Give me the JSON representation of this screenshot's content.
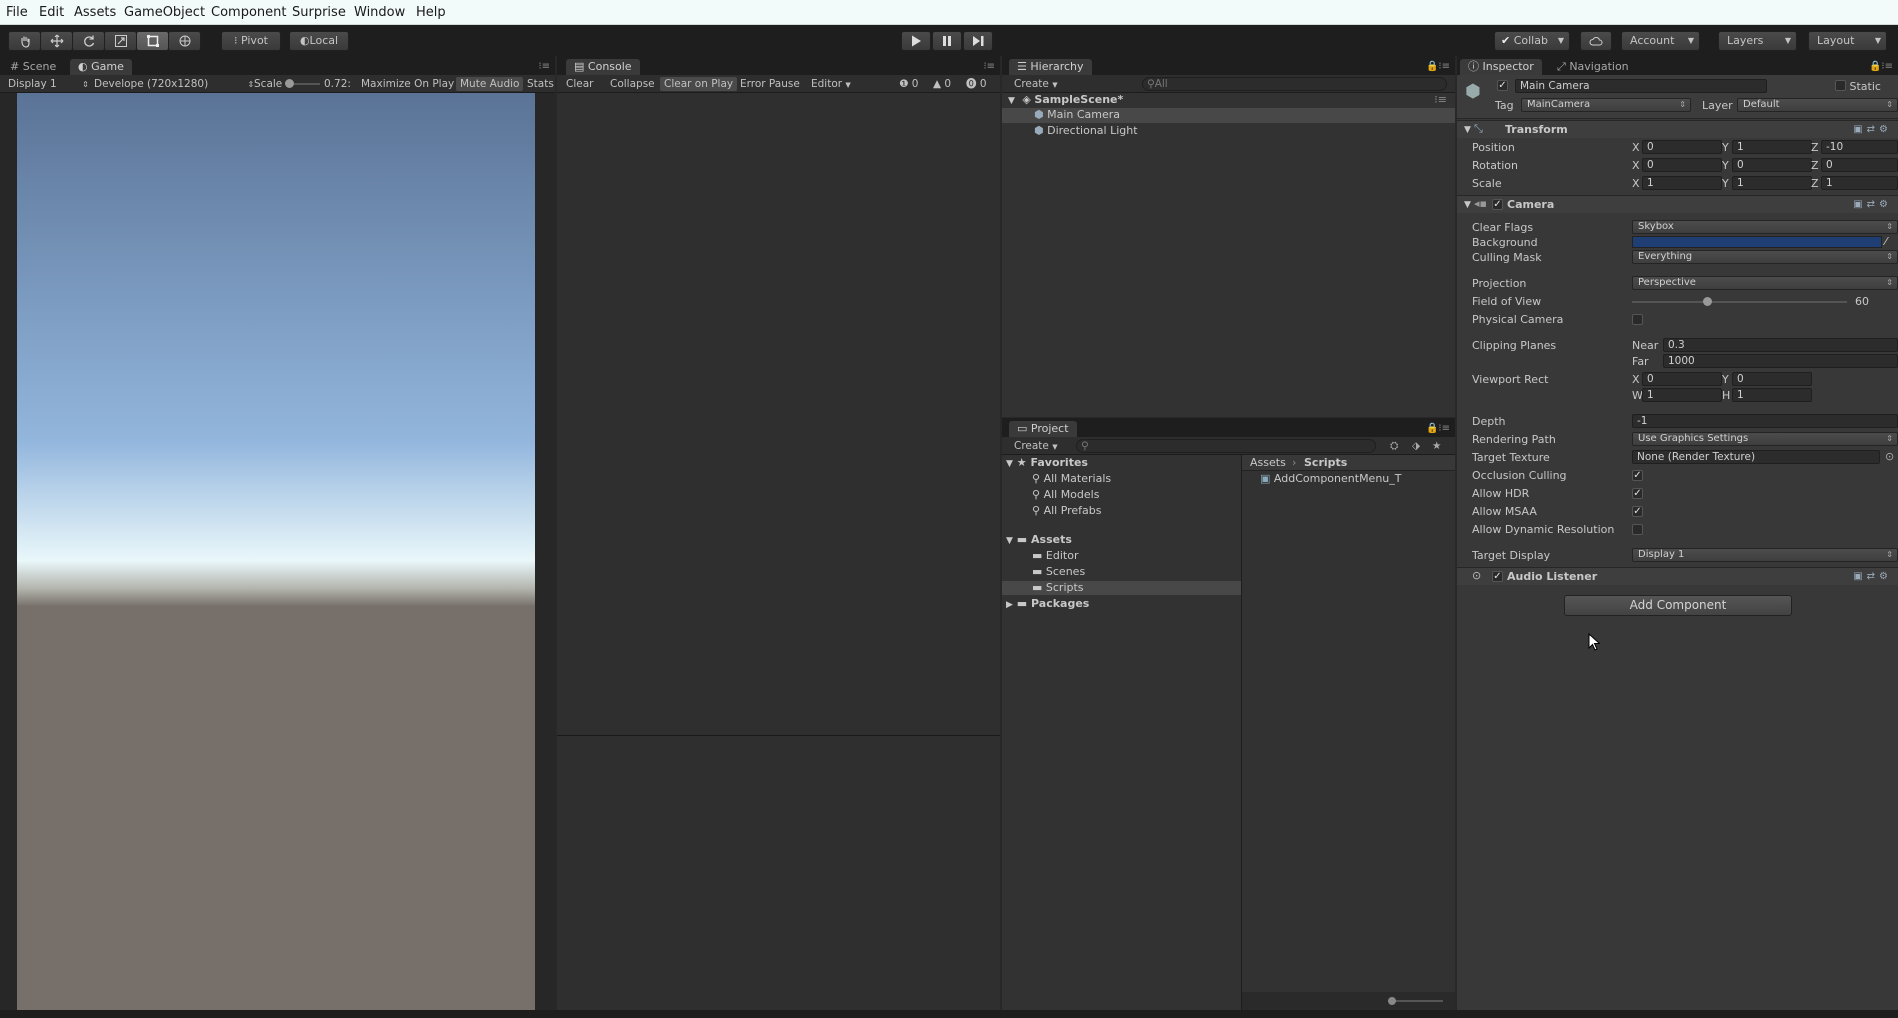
{
  "menu": [
    "File",
    "Edit",
    "Assets",
    "GameObject",
    "Component",
    "Surprise",
    "Window",
    "Help"
  ],
  "toolbar": {
    "tools": [
      "hand-icon",
      "move-icon",
      "rotate-icon",
      "scale-icon",
      "rect-icon",
      "transform-icon"
    ],
    "pivot": "Pivot",
    "local": "Local",
    "collab": "Collab",
    "account": "Account",
    "layers": "Layers",
    "layout": "Layout"
  },
  "game": {
    "tabs": [
      "Scene",
      "Game"
    ],
    "display": "Display 1",
    "resolution": "Develope (720x1280)",
    "scale_label": "Scale",
    "scale_value": "0.72:",
    "maximize": "Maximize On Play",
    "mute": "Mute Audio",
    "stats": "Stats",
    "sky_colors": [
      "#5a7396",
      "#93b6dd",
      "#e9f7fa",
      "#77706a"
    ]
  },
  "console": {
    "tab": "Console",
    "buttons": [
      "Clear",
      "Collapse",
      "Clear on Play",
      "Error Pause",
      "Editor"
    ],
    "counts": [
      "0",
      "0",
      "0"
    ]
  },
  "hierarchy": {
    "tab": "Hierarchy",
    "create": "Create",
    "search_placeholder": "All",
    "scene": "SampleScene*",
    "items": [
      "Main Camera",
      "Directional Light"
    ]
  },
  "project": {
    "tab": "Project",
    "create": "Create",
    "favorites_label": "Favorites",
    "favorites": [
      "All Materials",
      "All Models",
      "All Prefabs"
    ],
    "assets_label": "Assets",
    "folders": [
      "Editor",
      "Scenes",
      "Scripts"
    ],
    "packages_label": "Packages",
    "breadcrumb": [
      "Assets",
      "Scripts"
    ],
    "files": [
      "AddComponentMenu_T"
    ]
  },
  "inspector": {
    "tabs": [
      "Inspector",
      "Navigation"
    ],
    "object_name": "Main Camera",
    "static_label": "Static",
    "tag_label": "Tag",
    "tag_value": "MainCamera",
    "layer_label": "Layer",
    "layer_value": "Default",
    "transform": {
      "title": "Transform",
      "rows": [
        {
          "label": "Position",
          "x": "0",
          "y": "1",
          "z": "-10"
        },
        {
          "label": "Rotation",
          "x": "0",
          "y": "0",
          "z": "0"
        },
        {
          "label": "Scale",
          "x": "1",
          "y": "1",
          "z": "1"
        }
      ]
    },
    "camera": {
      "title": "Camera",
      "clear_flags_label": "Clear Flags",
      "clear_flags": "Skybox",
      "background_label": "Background",
      "background_color": "#1e3e74",
      "culling_label": "Culling Mask",
      "culling": "Everything",
      "projection_label": "Projection",
      "projection": "Perspective",
      "fov_label": "Field of View",
      "fov": "60",
      "fov_fraction": 0.33,
      "physical_label": "Physical Camera",
      "clipping_label": "Clipping Planes",
      "near_label": "Near",
      "near": "0.3",
      "far_label": "Far",
      "far": "1000",
      "viewport_label": "Viewport Rect",
      "vx": "0",
      "vy": "0",
      "vw": "1",
      "vh": "1",
      "depth_label": "Depth",
      "depth": "-1",
      "render_path_label": "Rendering Path",
      "render_path": "Use Graphics Settings",
      "target_tex_label": "Target Texture",
      "target_tex": "None (Render Texture)",
      "occlusion_label": "Occlusion Culling",
      "hdr_label": "Allow HDR",
      "msaa_label": "Allow MSAA",
      "dynres_label": "Allow Dynamic Resolution",
      "target_display_label": "Target Display",
      "target_display": "Display 1"
    },
    "audio_listener": "Audio Listener",
    "add_component": "Add Component"
  },
  "colors": {
    "accent": "#3a72b0",
    "checkbox": "#e0e0e0"
  }
}
